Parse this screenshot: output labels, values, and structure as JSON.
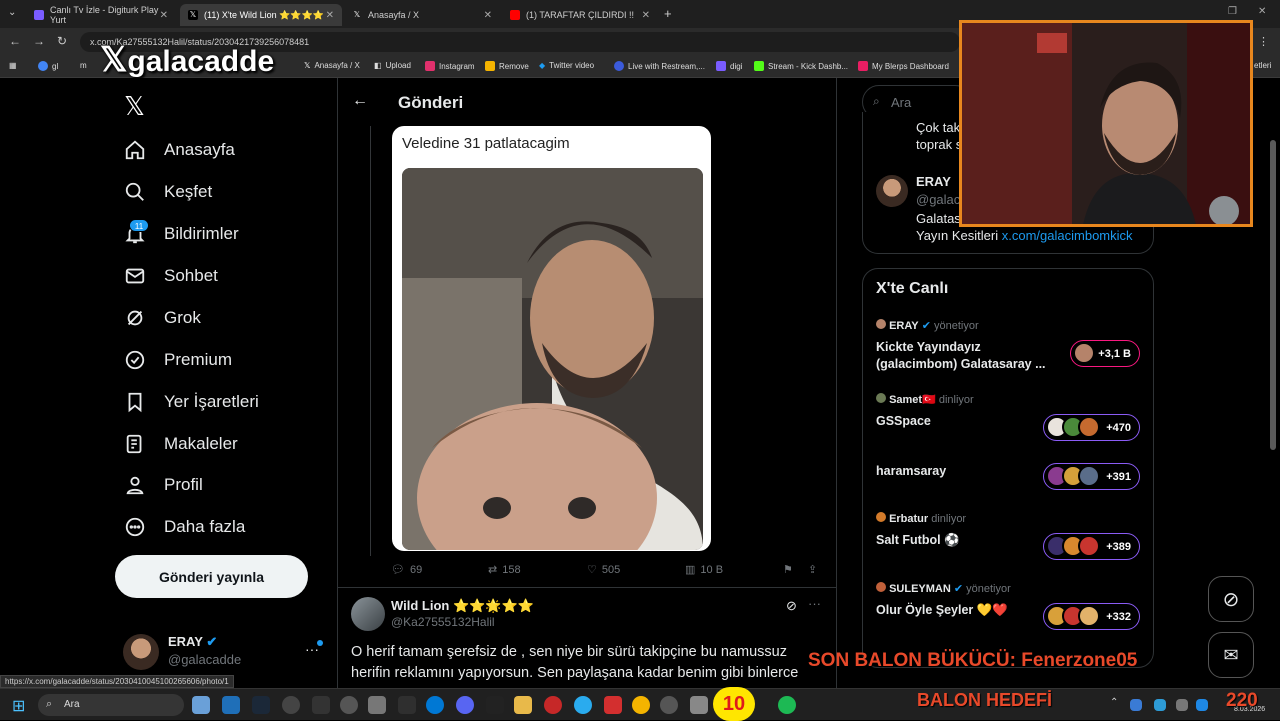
{
  "browser": {
    "tabs": [
      {
        "label": "Canlı Tv İzle - Digiturk Play Yurt",
        "favicon_color": "#7a5cff"
      },
      {
        "label": "(11) X'te Wild Lion ⭐⭐⭐⭐",
        "favicon_color": "#000000"
      },
      {
        "label": "Anasayfa / X",
        "favicon_color": "#000000"
      },
      {
        "label": "(1) TARAFTAR ÇILDIRDI !! Beşikt",
        "favicon_color": "#ff0000"
      }
    ],
    "url": "x.com/Ka27555132Halil/status/2030421739256078481",
    "bookmarks": [
      "gl",
      "m",
      "Anasayfa / X",
      "Upload",
      "Instagram",
      "Remove",
      "Twitter video",
      "Live with Restream,...",
      "digi",
      "Stream - Kick Dashb...",
      "My Blerps Dashboard",
      "etleri"
    ],
    "status_url": "https://x.com/galacadde/status/2030410045100265606/photo/1"
  },
  "overlay": {
    "logo_text": "galacadde",
    "ticker": "SON BALON BÜKÜCÜ: Fenerzone05",
    "goal_label": "BALON HEDEFİ",
    "goal_value": "220",
    "counter": "10"
  },
  "sidebar": {
    "items": [
      {
        "label": "Anasayfa",
        "icon": "home-icon"
      },
      {
        "label": "Keşfet",
        "icon": "search-icon"
      },
      {
        "label": "Bildirimler",
        "icon": "bell-icon",
        "badge": "11"
      },
      {
        "label": "Sohbet",
        "icon": "mail-icon"
      },
      {
        "label": "Grok",
        "icon": "grok-icon"
      },
      {
        "label": "Premium",
        "icon": "verified-icon"
      },
      {
        "label": "Yer İşaretleri",
        "icon": "bookmark-icon"
      },
      {
        "label": "Makaleler",
        "icon": "article-icon"
      },
      {
        "label": "Profil",
        "icon": "profile-icon"
      },
      {
        "label": "Daha fazla",
        "icon": "more-circle-icon"
      }
    ],
    "post_button": "Gönderi yayınla",
    "account_name": "ERAY",
    "account_handle": "@galacadde"
  },
  "main": {
    "header_title": "Gönderi",
    "quoted_text": "Veledine 31 patlatacagim",
    "actions": {
      "replies": "69",
      "reposts": "158",
      "likes": "505",
      "views": "10 B"
    },
    "reply": {
      "name": "Wild Lion ⭐⭐🌟⭐⭐",
      "handle": "@Ka27555132Halil",
      "text": "O herif tamam şerefsiz de , sen niye bir sürü takipçine bu namussuz herifin reklamını yapıyorsun. Sen paylaşana kadar benim gibi binlerce"
    }
  },
  "right": {
    "search_placeholder": "Ara",
    "top_card": {
      "line1": "Çok tak",
      "line2": "toprak s",
      "name": "ERAY",
      "handle": "@galac",
      "line3": "Galatas",
      "link_prefix": "Yayın Kesitleri",
      "link": "x.com/galacimbomkick"
    },
    "live_title": "X'te Canlı",
    "live": [
      {
        "host": "ERAY",
        "role": "yönetiyor",
        "title": "Kickte Yayındayız (galacimbom) Galatasaray ...",
        "count": "+3,1 B"
      },
      {
        "host": "Samet",
        "role": "dinliyor",
        "title": "GSSpace",
        "count": "+470"
      },
      {
        "host": "",
        "role": "",
        "title": "haramsaray",
        "count": "+391"
      },
      {
        "host": "Erbatur",
        "role": "dinliyor",
        "title": "Salt Futbol ⚽",
        "count": "+389"
      },
      {
        "host": "SULEYMAN",
        "role": "yönetiyor",
        "title": "Olur Öyle Şeyler 💛❤️",
        "count": "+332"
      }
    ]
  },
  "taskbar": {
    "search_placeholder": "Ara",
    "date": "8.03.2026"
  }
}
